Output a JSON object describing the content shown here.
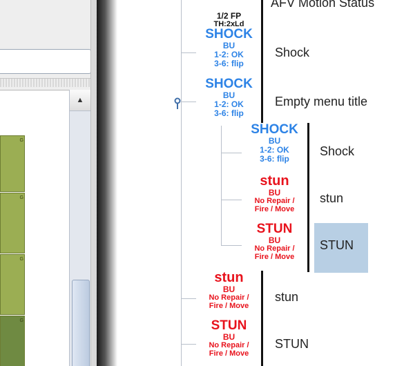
{
  "left_panel": {
    "list_tile_label": "G",
    "scroll_up_glyph": "▲"
  },
  "tree": {
    "top_partial": {
      "line1": "1/2 FP",
      "line2": "TH:2xLd",
      "label": "AFV Motion Status"
    },
    "nodes": [
      {
        "counter": {
          "title": "SHOCK",
          "sub": "BU",
          "l3": "1-2: OK",
          "l4": "3-6: flip"
        },
        "label": "Shock"
      },
      {
        "counter": {
          "title": "SHOCK",
          "sub": "BU",
          "l3": "1-2: OK",
          "l4": "3-6: flip"
        },
        "label": "Empty menu title"
      },
      {
        "counter": {
          "title": "SHOCK",
          "sub": "BU",
          "l3": "1-2: OK",
          "l4": "3-6: flip"
        },
        "label": "Shock"
      },
      {
        "counter": {
          "title": "stun",
          "sub": "BU",
          "l3": "No Repair /",
          "l4": "Fire / Move"
        },
        "label": "stun"
      },
      {
        "counter": {
          "title": "STUN",
          "sub": "BU",
          "l3": "No Repair /",
          "l4": "Fire / Move"
        },
        "label": "STUN"
      },
      {
        "counter": {
          "title": "stun",
          "sub": "BU",
          "l3": "No Repair /",
          "l4": "Fire / Move"
        },
        "label": "stun"
      },
      {
        "counter": {
          "title": "STUN",
          "sub": "BU",
          "l3": "No Repair /",
          "l4": "Fire / Move"
        },
        "label": "STUN"
      }
    ]
  },
  "colors": {
    "shock": "#2d83e6",
    "stun": "#e8121c",
    "selection": "#b8cfe4"
  },
  "icons": [
    "expand-handle-icon",
    "scroll-up-arrow-icon"
  ]
}
